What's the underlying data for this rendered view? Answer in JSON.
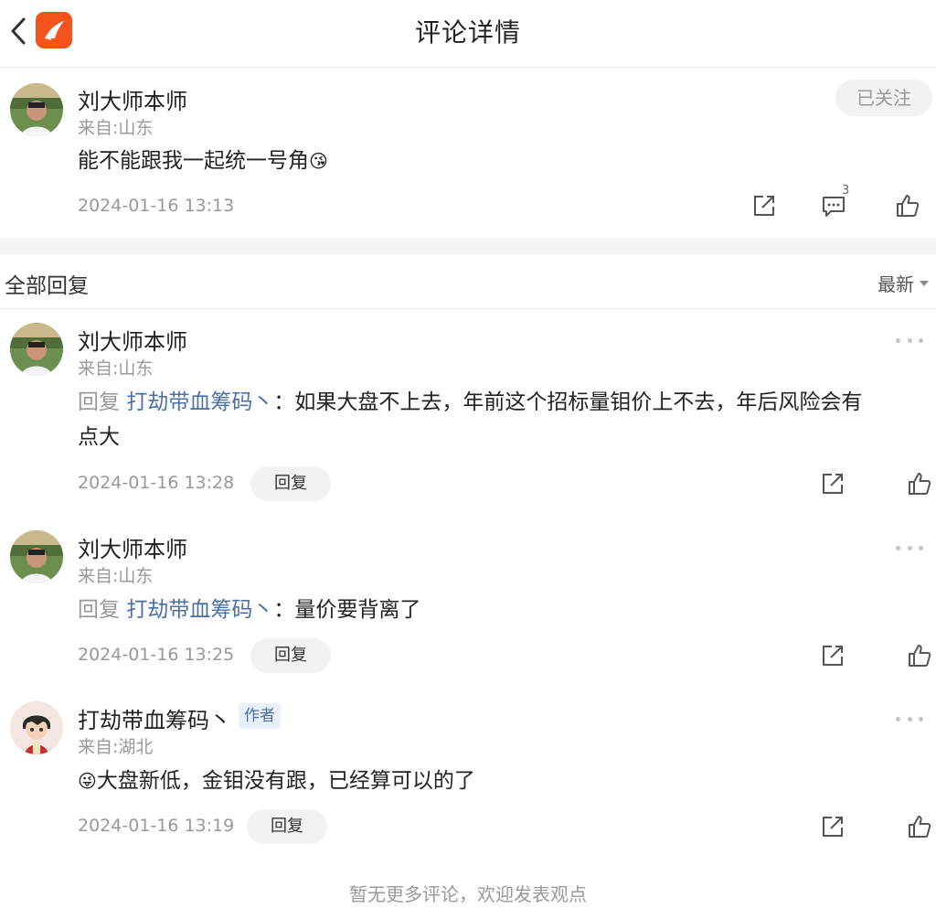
{
  "header": {
    "title": "评论详情",
    "back_icon": "chevron-left-icon",
    "logo_icon": "app-logo-icon"
  },
  "main_comment": {
    "user_name": "刘大师本师",
    "location": "来自:山东",
    "follow_label": "已关注",
    "text": "能不能跟我一起统一号角",
    "emoji": "😘",
    "timestamp": "2024-01-16 13:13",
    "comment_count": "3"
  },
  "replies_header": {
    "title": "全部回复",
    "sort_label": "最新"
  },
  "replies": [
    {
      "user_name": "刘大师本师",
      "location": "来自:山东",
      "prefix": "回复",
      "target": "打劫带血筹码丶",
      "separator": "：",
      "text_line1": "如果大盘不上去，年前这个招标量钼价上不去，年后风险会有",
      "text_line2": "点大",
      "timestamp": "2024-01-16 13:28",
      "reply_label": "回复"
    },
    {
      "user_name": "刘大师本师",
      "location": "来自:山东",
      "prefix": "回复",
      "target": "打劫带血筹码丶",
      "separator": "：",
      "text_line1": "量价要背离了",
      "timestamp": "2024-01-16 13:25",
      "reply_label": "回复"
    },
    {
      "user_name": "打劫带血筹码丶",
      "author_tag": "作者",
      "location": "来自:湖北",
      "emoji": "😜",
      "text_line1": "大盘新低，金钼没有跟，已经算可以的了",
      "timestamp": "2024-01-16 13:19",
      "reply_label": "回复"
    }
  ],
  "footer": {
    "note": "暂无更多评论，欢迎发表观点"
  },
  "colors": {
    "brand": "#f2541b",
    "link": "#4a6fa5",
    "muted": "#999999"
  }
}
